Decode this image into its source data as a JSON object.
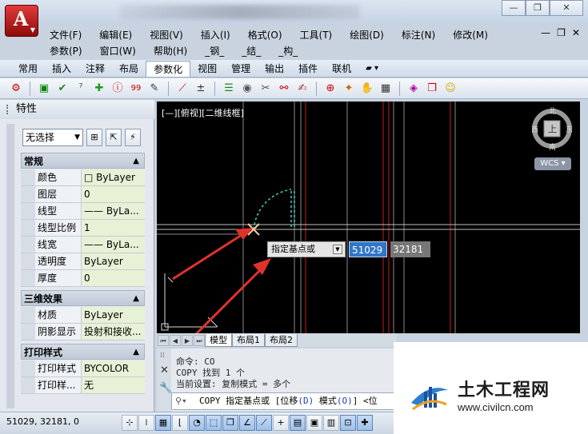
{
  "titlebar": {
    "app_button_icon": "autocad-logo-icon",
    "window_controls": [
      "—",
      "❐",
      "✕"
    ]
  },
  "menu": {
    "row1": [
      "文件(F)",
      "编辑(E)",
      "视图(V)",
      "插入(I)",
      "格式(O)",
      "工具(T)",
      "绘图(D)",
      "标注(N)",
      "修改(M)"
    ],
    "row2": [
      "参数(P)",
      "窗口(W)",
      "帮助(H)",
      "_钢_",
      "_结_",
      "_构_"
    ],
    "mdi_controls": [
      "—",
      "❐",
      "✕"
    ]
  },
  "ribbon_tabs": [
    "常用",
    "插入",
    "注释",
    "布局",
    "参数化",
    "视图",
    "管理",
    "输出",
    "插件",
    "联机"
  ],
  "active_tab": "参数化",
  "properties": {
    "title": "特性",
    "selection": "无选择",
    "sections": [
      {
        "name": "常规",
        "rows": [
          {
            "label": "颜色",
            "value": "□ ByLayer"
          },
          {
            "label": "图层",
            "value": "0"
          },
          {
            "label": "线型",
            "value": "—— ByLa..."
          },
          {
            "label": "线型比例",
            "value": "1"
          },
          {
            "label": "线宽",
            "value": "—— ByLa..."
          },
          {
            "label": "透明度",
            "value": "ByLayer"
          },
          {
            "label": "厚度",
            "value": "0"
          }
        ]
      },
      {
        "name": "三维效果",
        "rows": [
          {
            "label": "材质",
            "value": "ByLayer"
          },
          {
            "label": "阴影显示",
            "value": "投射和接收..."
          }
        ]
      },
      {
        "name": "打印样式",
        "rows": [
          {
            "label": "打印样式",
            "value": "BYCOLOR"
          },
          {
            "label": "打印样...",
            "value": "无"
          }
        ]
      }
    ]
  },
  "canvas": {
    "view_label": "[—][俯视][二维线框]",
    "background": "#000000",
    "viewcube": {
      "top": "上",
      "north": "北",
      "south": "南",
      "east": "东",
      "west": "西",
      "wcs": "WCS"
    }
  },
  "dynamic_input": {
    "prompt": "指定基点或",
    "value1": "51029",
    "value2": "32181"
  },
  "layout_tabs": [
    "模型",
    "布局1",
    "布局2"
  ],
  "command_line": {
    "lines": [
      "命令: CO",
      "COPY 找到 1 个",
      "当前设置:  复制模式 = 多个"
    ],
    "input_prefix": "COPY 指定基点或 [位移",
    "input_d": "(D)",
    "input_mid": "模式",
    "input_o": "(O)",
    "input_rest": "] <位"
  },
  "status": {
    "coords": "51029, 32181, 0"
  },
  "watermark": {
    "name": "土木工程网",
    "url": "www.civilcn.com"
  },
  "colors": {
    "accent_blue": "#3176c8",
    "red_line": "#c81e1e",
    "arrow_red": "#e0322c",
    "cyan_dash": "#44d0c8"
  }
}
